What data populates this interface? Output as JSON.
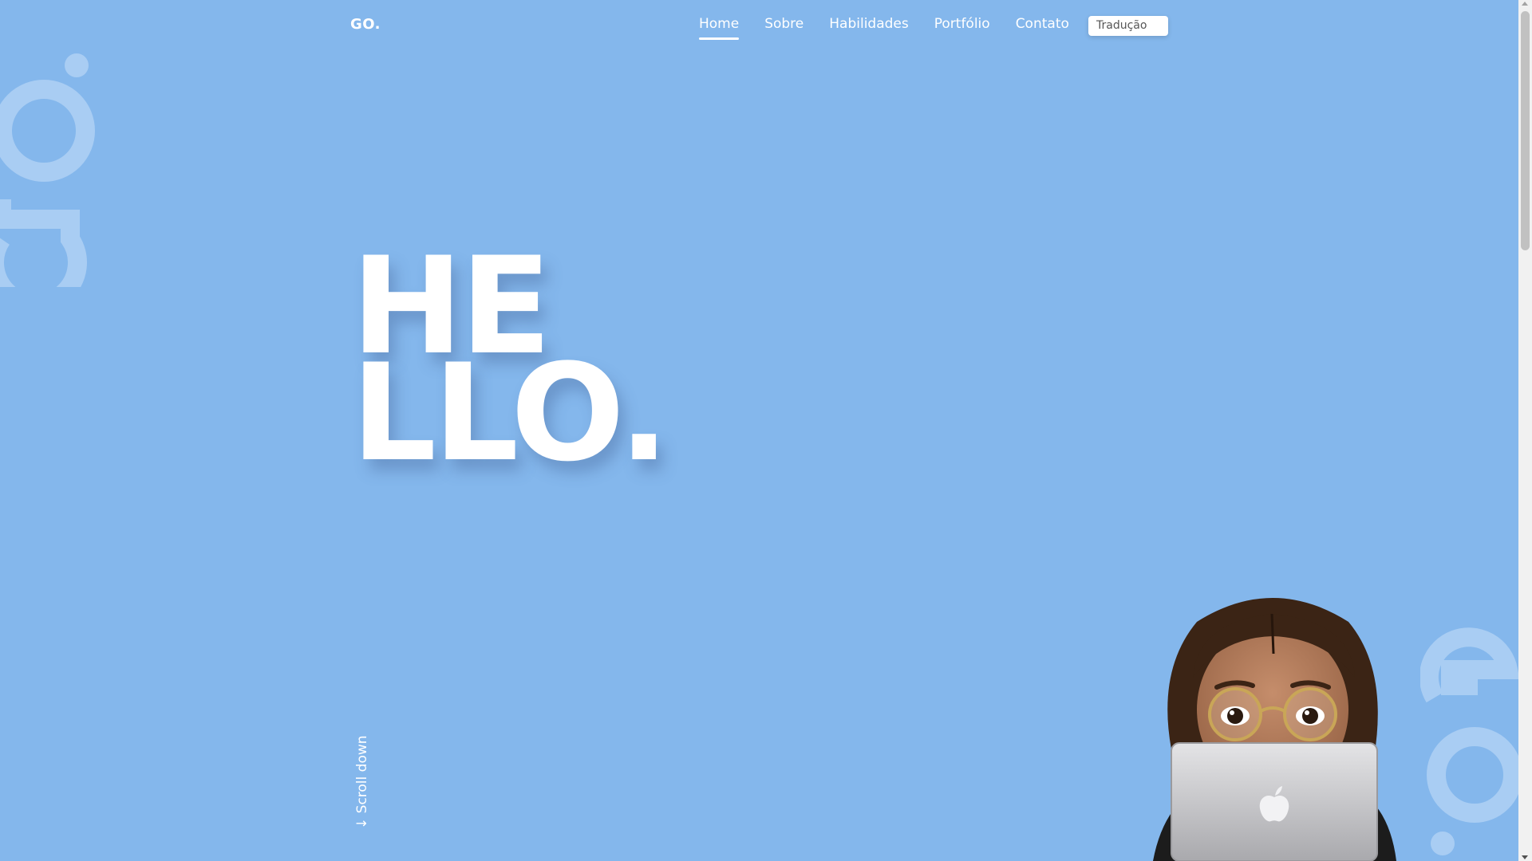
{
  "brand": {
    "logo": "GO."
  },
  "nav": {
    "items": [
      {
        "label": "Home",
        "active": true
      },
      {
        "label": "Sobre"
      },
      {
        "label": "Habilidades"
      },
      {
        "label": "Portfólio"
      },
      {
        "label": "Contato"
      }
    ],
    "translate_label": "Tradução"
  },
  "hero": {
    "line1": "HE",
    "line2": "LLO.",
    "scroll_label": "↓ Scroll down"
  },
  "colors": {
    "background": "#84b7ec",
    "text": "#ffffff",
    "watermark": "#a9cdf3"
  },
  "icons": {
    "avatar": "memoji-avatar-with-laptop",
    "laptop_logo": "apple-logo-icon",
    "watermark": "go-watermark-icon"
  }
}
